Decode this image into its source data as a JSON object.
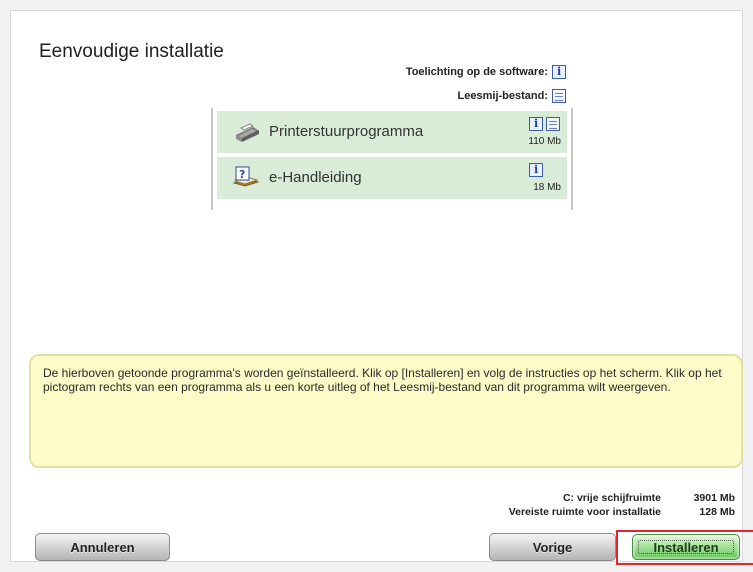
{
  "window": {
    "title": "Eenvoudige installatie"
  },
  "software_info": {
    "explanation_label": "Toelichting op de software:",
    "readme_label": "Leesmij-bestand:"
  },
  "programs": [
    {
      "name": "Printerstuurprogramma",
      "size": "110 Mb",
      "icon": "printer-icon",
      "tools": [
        "info-icon",
        "document-icon"
      ]
    },
    {
      "name": "e-Handleiding",
      "size": "18 Mb",
      "icon": "manual-book-icon",
      "tools": [
        "info-icon"
      ]
    }
  ],
  "message": {
    "text": "De hierboven getoonde programma's worden geïnstalleerd. Klik op [Installeren] en volg de instructies op het scherm. Klik op het pictogram rechts van een programma als u een korte uitleg of het Leesmij-bestand van dit programma wilt weergeven."
  },
  "disk_space": {
    "free_label": "C: vrije schijfruimte",
    "free_value": "3901 Mb",
    "required_label": "Vereiste ruimte voor installatie",
    "required_value": "128 Mb"
  },
  "buttons": {
    "cancel": "Annuleren",
    "previous": "Vorige",
    "install": "Installeren"
  },
  "colors": {
    "program_row": "#d8ecd7",
    "message_background": "#fdfbc7",
    "install_highlight": "#e5252c"
  }
}
